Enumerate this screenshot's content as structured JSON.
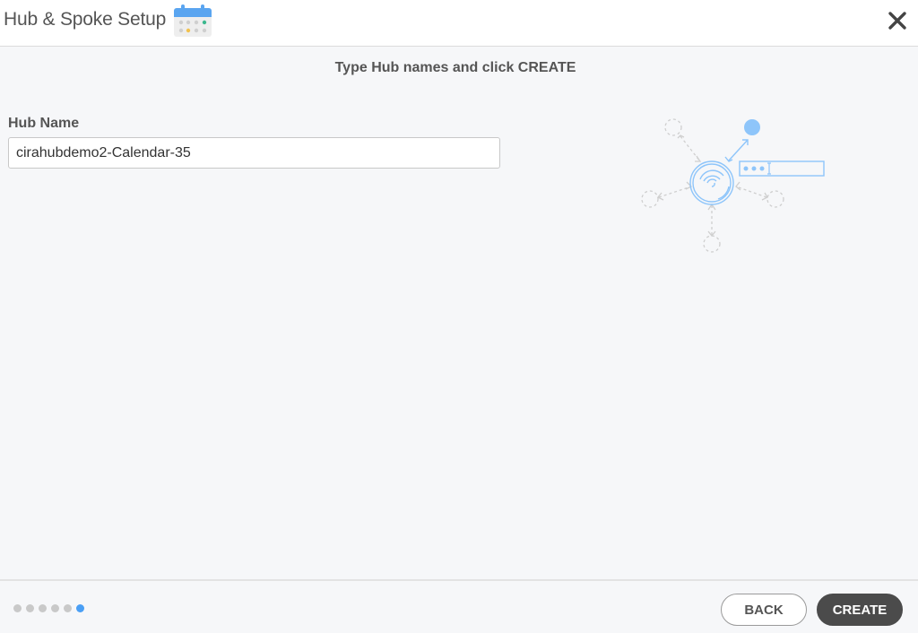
{
  "header": {
    "title": "Hub & Spoke Setup",
    "icon": "calendar-icon",
    "close_icon": "close-icon"
  },
  "main": {
    "instruction": "Type Hub names and click CREATE",
    "hub_name_label": "Hub Name",
    "hub_name_value": "cirahubdemo2-Calendar-35",
    "illustration": "hub-spoke-illustration"
  },
  "footer": {
    "steps_total": 6,
    "current_step": 6,
    "back_label": "BACK",
    "create_label": "CREATE"
  },
  "colors": {
    "accent_blue": "#4a9ff5",
    "illustration_blue": "#8ec5fa",
    "primary_button": "#4b4b4b",
    "inactive_dot": "#c9c9c9"
  }
}
